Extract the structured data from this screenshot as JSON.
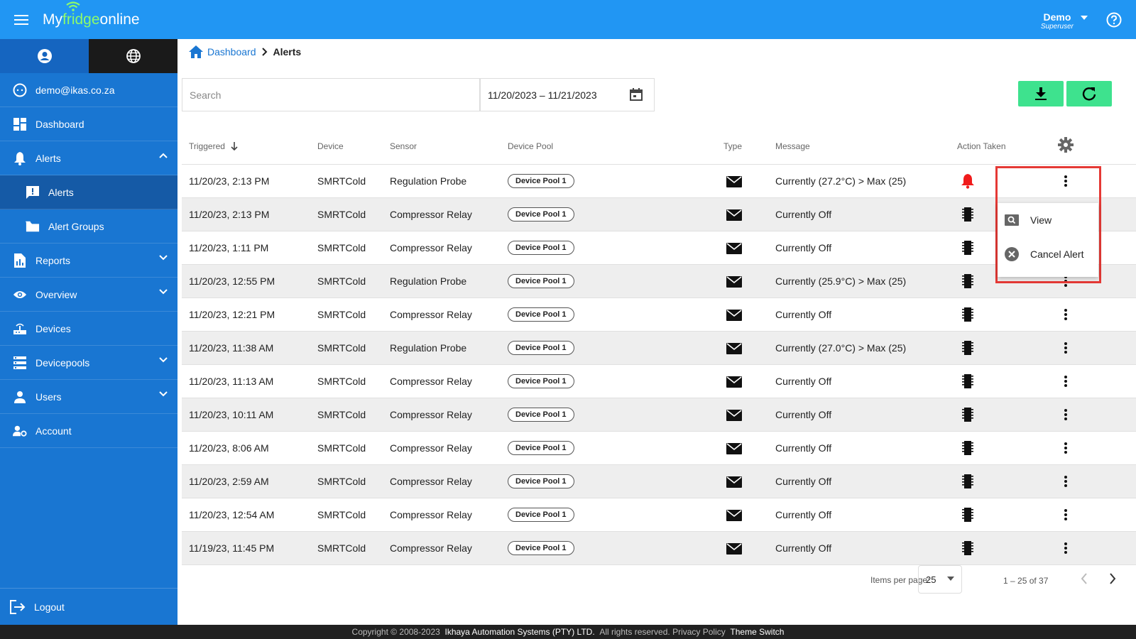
{
  "header": {
    "logo_part1": "My",
    "logo_part2": "fridge",
    "logo_part3": "online",
    "user_name": "Demo",
    "user_role": "Superuser"
  },
  "sidebar": {
    "email": "demo@ikas.co.za",
    "items": [
      {
        "label": "Dashboard",
        "icon": "dashboard-icon"
      },
      {
        "label": "Alerts",
        "icon": "bell-icon",
        "expanded": true
      },
      {
        "label": "Alerts",
        "icon": "alert-message-icon",
        "sub": true,
        "selected": true
      },
      {
        "label": "Alert Groups",
        "icon": "folder-icon",
        "sub": true
      },
      {
        "label": "Reports",
        "icon": "report-icon"
      },
      {
        "label": "Overview",
        "icon": "eye-icon"
      },
      {
        "label": "Devices",
        "icon": "router-icon"
      },
      {
        "label": "Devicepools",
        "icon": "storage-icon"
      },
      {
        "label": "Users",
        "icon": "person-icon"
      },
      {
        "label": "Account",
        "icon": "manage-account-icon"
      }
    ],
    "logout": "Logout"
  },
  "breadcrumb": {
    "home": "Dashboard",
    "current": "Alerts"
  },
  "toolbar": {
    "search_placeholder": "Search",
    "date_range": "11/20/2023 – 11/21/2023"
  },
  "table": {
    "columns": {
      "triggered": "Triggered",
      "device": "Device",
      "sensor": "Sensor",
      "device_pool": "Device Pool",
      "type": "Type",
      "message": "Message",
      "action_taken": "Action Taken"
    },
    "rows": [
      {
        "triggered": "11/20/23, 2:13 PM",
        "device": "SMRTCold",
        "sensor": "Regulation Probe",
        "pool": "Device Pool 1",
        "message": "Currently (27.2°C) > Max (25)",
        "action": "bell"
      },
      {
        "triggered": "11/20/23, 2:13 PM",
        "device": "SMRTCold",
        "sensor": "Compressor Relay",
        "pool": "Device Pool 1",
        "message": "Currently Off",
        "action": "chip"
      },
      {
        "triggered": "11/20/23, 1:11 PM",
        "device": "SMRTCold",
        "sensor": "Compressor Relay",
        "pool": "Device Pool 1",
        "message": "Currently Off",
        "action": "chip"
      },
      {
        "triggered": "11/20/23, 12:55 PM",
        "device": "SMRTCold",
        "sensor": "Regulation Probe",
        "pool": "Device Pool 1",
        "message": "Currently (25.9°C) > Max (25)",
        "action": "chip"
      },
      {
        "triggered": "11/20/23, 12:21 PM",
        "device": "SMRTCold",
        "sensor": "Compressor Relay",
        "pool": "Device Pool 1",
        "message": "Currently Off",
        "action": "chip"
      },
      {
        "triggered": "11/20/23, 11:38 AM",
        "device": "SMRTCold",
        "sensor": "Regulation Probe",
        "pool": "Device Pool 1",
        "message": "Currently (27.0°C) > Max (25)",
        "action": "chip"
      },
      {
        "triggered": "11/20/23, 11:13 AM",
        "device": "SMRTCold",
        "sensor": "Compressor Relay",
        "pool": "Device Pool 1",
        "message": "Currently Off",
        "action": "chip"
      },
      {
        "triggered": "11/20/23, 10:11 AM",
        "device": "SMRTCold",
        "sensor": "Compressor Relay",
        "pool": "Device Pool 1",
        "message": "Currently Off",
        "action": "chip"
      },
      {
        "triggered": "11/20/23, 8:06 AM",
        "device": "SMRTCold",
        "sensor": "Compressor Relay",
        "pool": "Device Pool 1",
        "message": "Currently Off",
        "action": "chip"
      },
      {
        "triggered": "11/20/23, 2:59 AM",
        "device": "SMRTCold",
        "sensor": "Compressor Relay",
        "pool": "Device Pool 1",
        "message": "Currently Off",
        "action": "chip"
      },
      {
        "triggered": "11/20/23, 12:54 AM",
        "device": "SMRTCold",
        "sensor": "Compressor Relay",
        "pool": "Device Pool 1",
        "message": "Currently Off",
        "action": "chip"
      },
      {
        "triggered": "11/19/23, 11:45 PM",
        "device": "SMRTCold",
        "sensor": "Compressor Relay",
        "pool": "Device Pool 1",
        "message": "Currently Off",
        "action": "chip"
      }
    ]
  },
  "context_menu": {
    "view": "View",
    "cancel": "Cancel Alert"
  },
  "pager": {
    "items_per_page_label": "Items per page:",
    "items_per_page": "25",
    "range": "1 – 25 of 37"
  },
  "footer": {
    "copyright": "Copyright © 2008-2023",
    "company": "Ikhaya Automation Systems (PTY) LTD.",
    "rights": "All rights reserved.",
    "privacy": "Privacy Policy",
    "theme": "Theme Switch"
  },
  "colors": {
    "topbar": "#2196f3",
    "sidebar": "#1976d2",
    "accent_green": "#3ee28e",
    "alert_red": "#e53935"
  }
}
